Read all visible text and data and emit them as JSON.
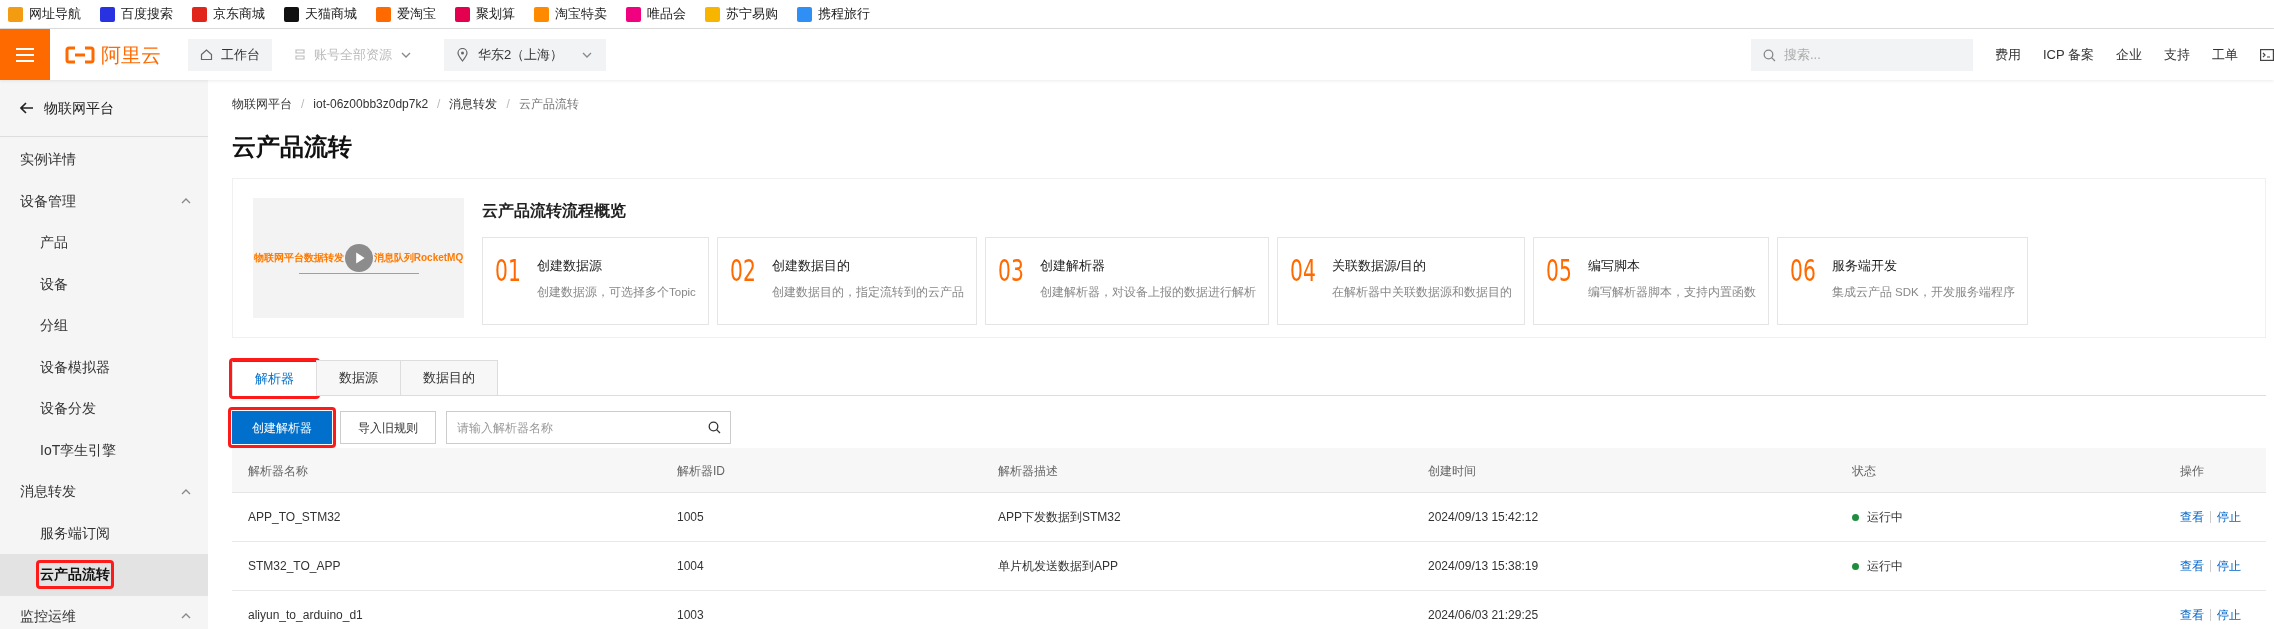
{
  "bookmarks": [
    {
      "label": "网址导航",
      "color": "#f39c12"
    },
    {
      "label": "百度搜索",
      "color": "#2932e1"
    },
    {
      "label": "京东商城",
      "color": "#e1251b"
    },
    {
      "label": "天猫商城",
      "color": "#111111"
    },
    {
      "label": "爱淘宝",
      "color": "#ff6a00"
    },
    {
      "label": "聚划算",
      "color": "#e5004f"
    },
    {
      "label": "淘宝特卖",
      "color": "#ff8a00"
    },
    {
      "label": "唯品会",
      "color": "#f10180"
    },
    {
      "label": "苏宁易购",
      "color": "#f7b500"
    },
    {
      "label": "携程旅行",
      "color": "#2f8ff5"
    }
  ],
  "topnav": {
    "logo": "阿里云",
    "workbench": "工作台",
    "resources": {
      "label": "账号全部资源",
      "disabled": true
    },
    "region": "华东2（上海）",
    "search": {
      "placeholder": "搜索..."
    },
    "links": [
      "费用",
      "ICP 备案",
      "企业",
      "支持",
      "工单"
    ]
  },
  "sidebar": {
    "back": "物联网平台",
    "items": [
      {
        "label": "实例详情",
        "kind": "item",
        "selected": false,
        "circled": false
      },
      {
        "label": "设备管理",
        "kind": "group",
        "expanded": true,
        "children": [
          {
            "label": "产品",
            "selected": false,
            "circled": false
          },
          {
            "label": "设备",
            "selected": false,
            "circled": false
          },
          {
            "label": "分组",
            "selected": false,
            "circled": false
          },
          {
            "label": "设备模拟器",
            "selected": false,
            "circled": false
          },
          {
            "label": "设备分发",
            "selected": false,
            "circled": false
          },
          {
            "label": "IoT孪生引擎",
            "selected": false,
            "circled": false
          }
        ]
      },
      {
        "label": "消息转发",
        "kind": "group",
        "expanded": true,
        "children": [
          {
            "label": "服务端订阅",
            "selected": false,
            "circled": false
          },
          {
            "label": "云产品流转",
            "selected": true,
            "circled": true
          }
        ]
      },
      {
        "label": "监控运维",
        "kind": "group",
        "expanded": true
      }
    ]
  },
  "breadcrumb": {
    "separator": "/",
    "items": [
      "物联网平台",
      "iot-06z00bb3z0dp7k2",
      "消息转发",
      "云产品流转"
    ]
  },
  "page_title": "云产品流转",
  "overview": {
    "video_caption": [
      "物联网平台数据转发",
      "消息队列RocketMQ"
    ],
    "title": "云产品流转流程概览",
    "steps": [
      {
        "number": "01",
        "title": "创建数据源",
        "description": "创建数据源，可选择多个Topic"
      },
      {
        "number": "02",
        "title": "创建数据目的",
        "description": "创建数据目的，指定流转到的云产品"
      },
      {
        "number": "03",
        "title": "创建解析器",
        "description": "创建解析器，对设备上报的数据进行解析"
      },
      {
        "number": "04",
        "title": "关联数据源/目的",
        "description": "在解析器中关联数据源和数据目的"
      },
      {
        "number": "05",
        "title": "编写脚本",
        "description": "编写解析器脚本，支持内置函数"
      },
      {
        "number": "06",
        "title": "服务端开发",
        "description": "集成云产品 SDK，开发服务端程序"
      }
    ]
  },
  "tabs": [
    {
      "label": "解析器",
      "selected": true,
      "circled": true
    },
    {
      "label": "数据源",
      "selected": false,
      "circled": false
    },
    {
      "label": "数据目的",
      "selected": false,
      "circled": false
    }
  ],
  "toolbar": {
    "create_button": {
      "label": "创建解析器",
      "circled": true
    },
    "import_button": "导入旧规则",
    "search": {
      "placeholder": "请输入解析器名称"
    }
  },
  "table": {
    "columns": [
      "解析器名称",
      "解析器ID",
      "解析器描述",
      "创建时间",
      "状态",
      "操作"
    ],
    "rows": [
      {
        "name": "APP_TO_STM32",
        "id": "1005",
        "description": "APP下发数据到STM32",
        "created": "2024/09/13 15:42:12",
        "status": "运行中",
        "color": "#1e8e3e",
        "actions": [
          "查看",
          "停止"
        ]
      },
      {
        "name": "STM32_TO_APP",
        "id": "1004",
        "description": "单片机发送数据到APP",
        "created": "2024/09/13 15:38:19",
        "status": "运行中",
        "color": "#1e8e3e",
        "actions": [
          "查看",
          "停止"
        ]
      },
      {
        "name": "aliyun_to_arduino_d1",
        "id": "1003",
        "created": "2024/06/03 21:29:25",
        "actions": [
          "查看",
          "停止"
        ]
      }
    ]
  }
}
